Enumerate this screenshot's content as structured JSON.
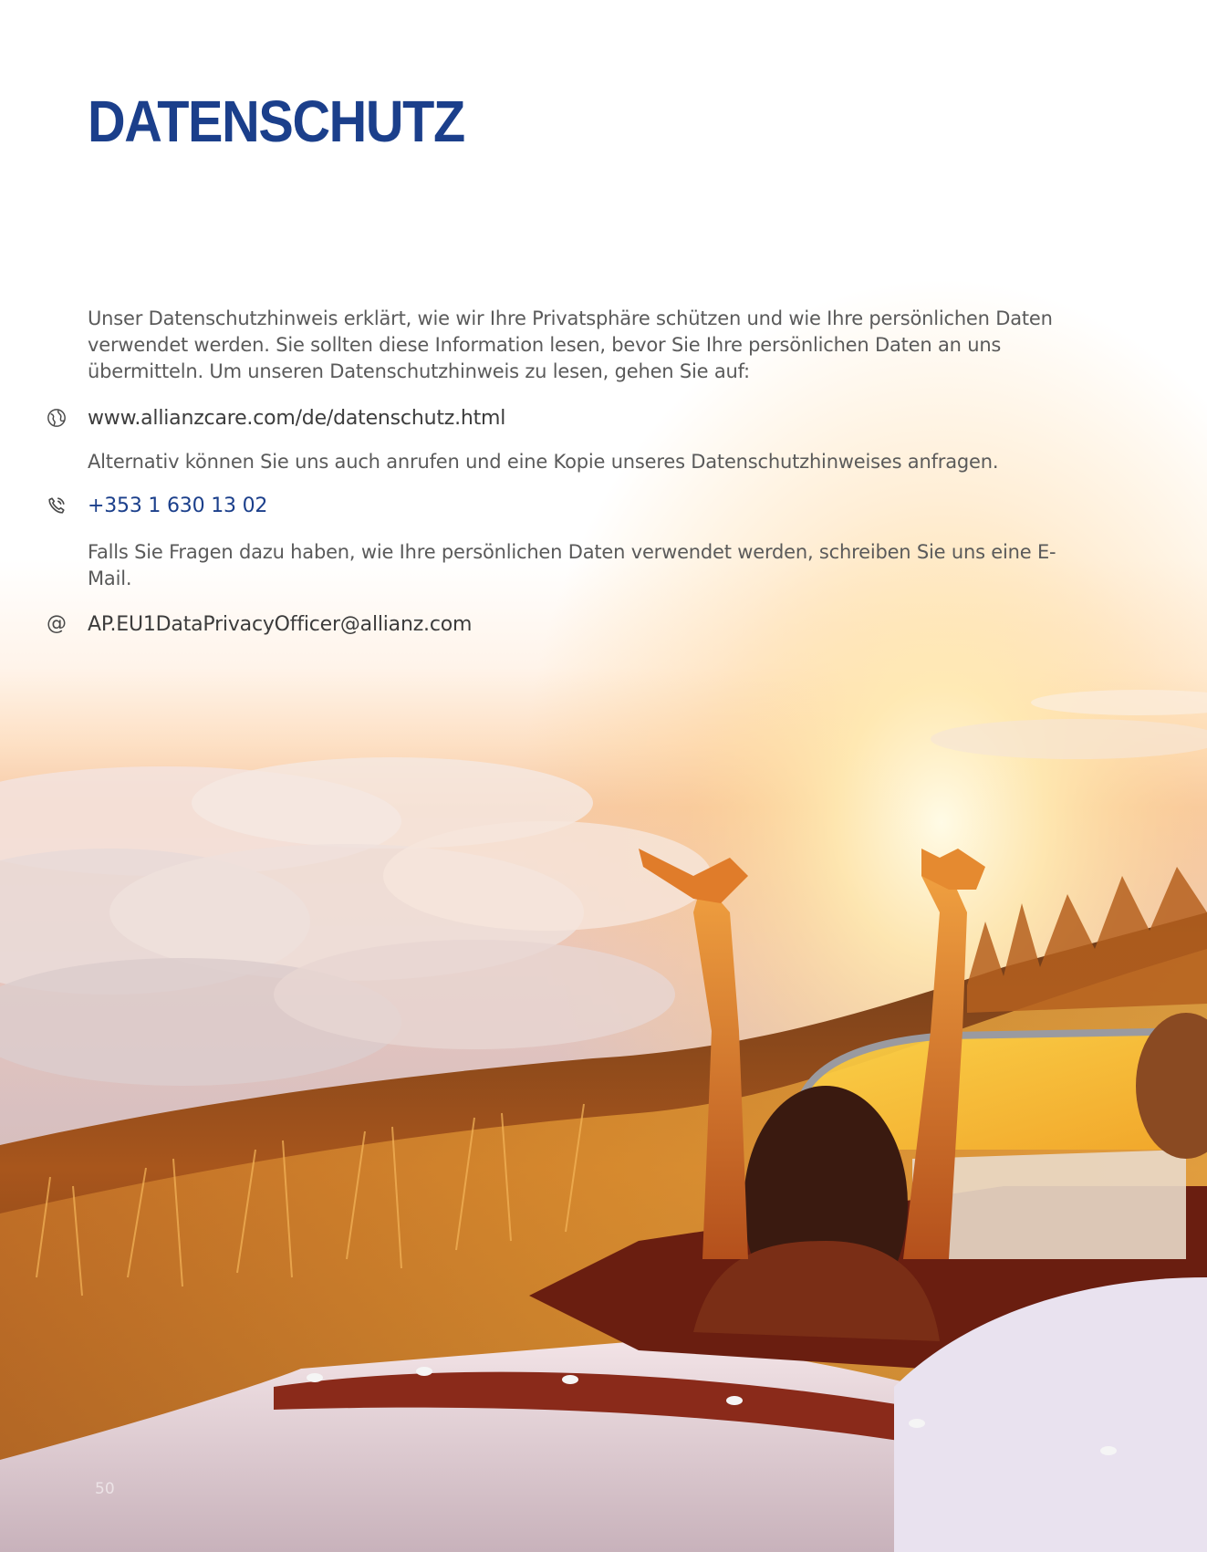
{
  "page": {
    "title": "DATENSCHUTZ",
    "intro": "Unser Datenschutzhinweis erklärt, wie wir Ihre Privatsphäre schützen und wie Ihre persönlichen Daten verwendet werden. Sie sollten diese Information lesen, bevor Sie Ihre persönlichen Daten an uns übermitteln. Um unseren Datenschutzhinweis zu lesen, gehen Sie auf:",
    "website": "www.allianzcare.com/de/datenschutz.html",
    "phone_intro": "Alternativ können Sie uns auch anrufen und eine Kopie unseres Datenschutzhinweises anfragen.",
    "phone": "+353 1 630 13 02",
    "email_intro": "Falls Sie Fragen dazu haben, wie Ihre persönlichen Daten verwendet werden, schreiben Sie uns eine E-Mail.",
    "email": "AP.EU1DataPrivacyOfficer@allianz.com",
    "page_number": "50"
  },
  "icons": {
    "website": "globe-icon",
    "phone": "phone-icon",
    "email": "at-sign-icon"
  },
  "colors": {
    "title": "#1b3f8b",
    "body_text": "#5a5a5a",
    "link_blue": "#1b3f8b"
  }
}
